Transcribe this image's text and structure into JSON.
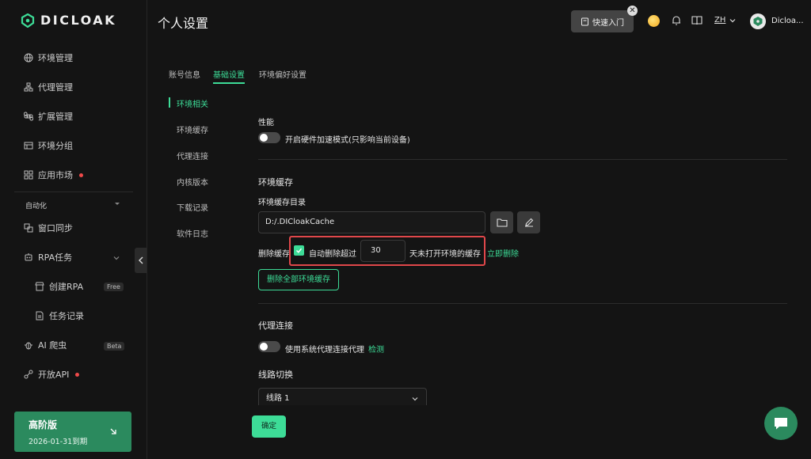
{
  "app": {
    "brand": "DICLOAK"
  },
  "sidebar": {
    "items": [
      {
        "label": "环境管理",
        "icon": "globe-icon"
      },
      {
        "label": "代理管理",
        "icon": "network-icon"
      },
      {
        "label": "扩展管理",
        "icon": "command-icon"
      },
      {
        "label": "环境分组",
        "icon": "group-icon"
      },
      {
        "label": "应用市场",
        "icon": "apps-icon",
        "dot": true
      }
    ],
    "automation_label": "自动化",
    "automation_items": [
      {
        "label": "窗口同步",
        "icon": "sync-icon"
      },
      {
        "label": "RPA任务",
        "icon": "robot-icon"
      },
      {
        "label": "创建RPA",
        "icon": "store-icon",
        "tag": "Free"
      },
      {
        "label": "任务记录",
        "icon": "document-icon"
      },
      {
        "label": "AI 爬虫",
        "icon": "bug-icon",
        "tag": "Beta"
      },
      {
        "label": "开放API",
        "icon": "api-icon",
        "dot": true
      }
    ],
    "promo": {
      "title": "高阶版",
      "date": "2026-01-31到期"
    }
  },
  "header": {
    "title": "个人设置",
    "quick_start": "快速入门",
    "language": "ZH",
    "username": "Dicloa..."
  },
  "tabs": [
    {
      "label": "账号信息",
      "active": false
    },
    {
      "label": "基础设置",
      "active": true
    },
    {
      "label": "环境偏好设置",
      "active": false
    }
  ],
  "subnav": [
    {
      "label": "环境相关",
      "active": true
    },
    {
      "label": "环境缓存",
      "active": false
    },
    {
      "label": "代理连接",
      "active": false
    },
    {
      "label": "内核版本",
      "active": false
    },
    {
      "label": "下载记录",
      "active": false
    },
    {
      "label": "软件日志",
      "active": false
    }
  ],
  "performance": {
    "title": "性能",
    "hw_accel_label": "开启硬件加速模式(只影响当前设备)",
    "hw_accel_enabled": false
  },
  "cache": {
    "title": "环境缓存",
    "dir_label": "环境缓存目录",
    "dir_value": "D:/.DICloakCache",
    "delete_label": "删除缓存",
    "auto_delete_label": "自动删除超过",
    "auto_delete_checked": true,
    "days_value": "30",
    "days_suffix": "天未打开环境的缓存",
    "delete_now": "立即删除",
    "clear_all": "删除全部环境缓存"
  },
  "proxy": {
    "title": "代理连接",
    "system_proxy_label": "使用系统代理连接代理",
    "system_proxy_enabled": false,
    "detect": "检测"
  },
  "route": {
    "title": "线路切换",
    "selected": "线路 1"
  },
  "confirm": "确定",
  "colors": {
    "accent": "#3ddc97",
    "highlight": "#e0474a",
    "brand_green": "#2b8a5e"
  }
}
